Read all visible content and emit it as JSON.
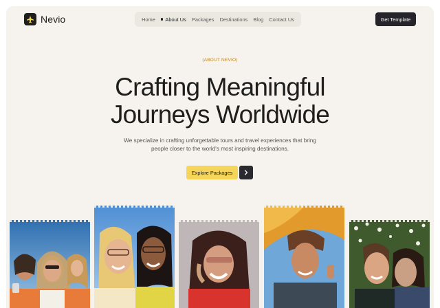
{
  "brand": {
    "name": "Nevio"
  },
  "nav": {
    "items": [
      {
        "label": "Home",
        "active": false
      },
      {
        "label": "About Us",
        "active": true
      },
      {
        "label": "Packages",
        "active": false
      },
      {
        "label": "Destinations",
        "active": false
      },
      {
        "label": "Blog",
        "active": false
      },
      {
        "label": "Contact Us",
        "active": false
      }
    ]
  },
  "header": {
    "cta_label": "Get Template"
  },
  "hero": {
    "eyebrow": "(ABOUT NEVIO)",
    "headline_line1": "Crafting Meaningful",
    "headline_line2": "Journeys Worldwide",
    "subtitle": "We specialize in crafting unforgettable tours and travel experiences that bring people closer to the world's most inspiring destinations.",
    "cta_label": "Explore Packages",
    "cta_arrow_icon": "arrow-right-icon"
  },
  "gallery": {
    "photos": [
      {
        "subject": "group-of-friends-selfie"
      },
      {
        "subject": "two-friends-smiling"
      },
      {
        "subject": "woman-laughing-sunglasses"
      },
      {
        "subject": "man-smiling-under-umbrella"
      },
      {
        "subject": "couple-in-flowers"
      }
    ]
  },
  "colors": {
    "background": "#f6f3ee",
    "accent_yellow": "#f6d65a",
    "eyebrow_orange": "#c28417",
    "dark": "#24242a"
  }
}
